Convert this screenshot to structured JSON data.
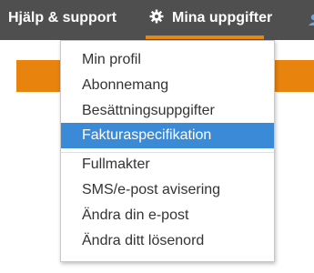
{
  "nav": {
    "help_label": "Hjälp & support",
    "tasks_label": "Mina uppgifter",
    "tasks_icon": "gear-icon",
    "accent_color": "#e8870f",
    "bar_color": "#4f4f4f"
  },
  "dropdown": {
    "items": [
      {
        "label": "Min profil",
        "active": false
      },
      {
        "label": "Abonnemang",
        "active": false
      },
      {
        "label": "Besättningsuppgifter",
        "active": false
      },
      {
        "label": "Fakturaspecifikation",
        "active": true
      },
      {
        "label": "Fullmakter",
        "active": false
      },
      {
        "label": "SMS/e-post avisering",
        "active": false
      },
      {
        "label": "Ändra din e-post",
        "active": false
      },
      {
        "label": "Ändra ditt lösenord",
        "active": false
      }
    ],
    "highlight_color": "#3b8ad8"
  }
}
